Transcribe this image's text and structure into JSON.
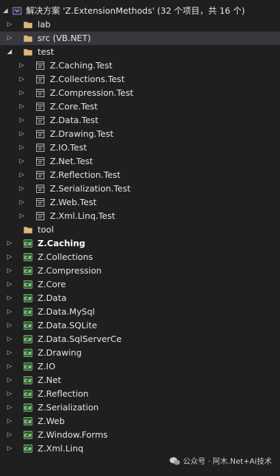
{
  "solution": {
    "label": "解决方案 'Z.ExtensionMethods' (32 个项目，共 16 个)"
  },
  "folders": {
    "lab": "lab",
    "src": "src (VB.NET)",
    "test": "test",
    "tool": "tool"
  },
  "test_projects": [
    "Z.Caching.Test",
    "Z.Collections.Test",
    "Z.Compression.Test",
    "Z.Core.Test",
    "Z.Data.Test",
    "Z.Drawing.Test",
    "Z.IO.Test",
    "Z.Net.Test",
    "Z.Reflection.Test",
    "Z.Serialization.Test",
    "Z.Web.Test",
    "Z.Xml.Linq.Test"
  ],
  "projects": [
    "Z.Caching",
    "Z.Collections",
    "Z.Compression",
    "Z.Core",
    "Z.Data",
    "Z.Data.MySql",
    "Z.Data.SQLite",
    "Z.Data.SqlServerCe",
    "Z.Drawing",
    "Z.IO",
    "Z.Net",
    "Z.Reflection",
    "Z.Serialization",
    "Z.Web",
    "Z.Window.Forms",
    "Z.Xml.Linq"
  ],
  "watermark": "公众号 · 阿木.Net+Ai技术",
  "colors": {
    "background": "#1f1f1f",
    "folder": "#dcb67a",
    "csharp": "#68b36b",
    "selected_row": "#37373d"
  }
}
